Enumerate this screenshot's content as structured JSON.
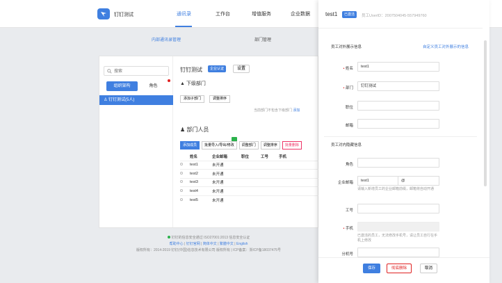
{
  "app": {
    "title": "钉钉测试"
  },
  "topnav": [
    {
      "label": "通讯录",
      "active": true
    },
    {
      "label": "工作台",
      "active": false
    },
    {
      "label": "增值服务",
      "active": false
    },
    {
      "label": "企业数据",
      "active": false
    }
  ],
  "subnav": [
    {
      "label": "内部通讯录管理",
      "active": true
    },
    {
      "label": "部门管理",
      "active": false
    }
  ],
  "left": {
    "search_placeholder": "搜索",
    "tabs": [
      {
        "label": "组织架构",
        "active": true
      },
      {
        "label": "角色",
        "active": false
      }
    ],
    "tree_item": "钉钉测试(5人)"
  },
  "org": {
    "name": "钉钉测试",
    "badge": "企业认证",
    "settings_label": "设置",
    "sub_dept_title": "下级部门",
    "add_sub_dept": "添加子部门",
    "sort": "调整排序",
    "note": "当前部门不包含下级部门",
    "note_link": "添加",
    "members_title": "部门人员"
  },
  "member_toolbar": [
    "添加成员",
    "批量导入/导出/修改",
    "调整部门",
    "调整排序",
    "批量删除"
  ],
  "table": {
    "headers": [
      "",
      "姓名",
      "企业邮箱",
      "职位",
      "工号",
      "手机"
    ],
    "rows": [
      {
        "name": "test1",
        "email": "未开通"
      },
      {
        "name": "test2",
        "email": "未开通"
      },
      {
        "name": "test3",
        "email": "未开通"
      },
      {
        "name": "test4",
        "email": "未开通"
      },
      {
        "name": "test5",
        "email": "未开通"
      }
    ]
  },
  "footer": {
    "line1": "钉钉的信息安全通过 ISO27001:2013 信息安全认证",
    "links": [
      "帮助中心",
      "钉钉官网",
      "简体中文",
      "繁體中文",
      "English"
    ],
    "line3": "版权所有：2014-2019 钉钉(中国)信息技术有限公司 版权所有 | ICP备案：浙ICP备18037475号"
  },
  "panel": {
    "name": "test1",
    "badge": "已激活",
    "userid": "员工UserID：2007504045-557949760",
    "section1": "员工对外展示信息",
    "section1_link": "自定义员工对外展示的信息",
    "fields1": [
      {
        "label": "姓名",
        "required": true,
        "value": "test1"
      },
      {
        "label": "部门",
        "required": true,
        "value": "钉钉测试"
      },
      {
        "label": "职位",
        "required": false,
        "value": ""
      },
      {
        "label": "邮箱",
        "required": false,
        "value": ""
      }
    ],
    "section2": "员工对内隐藏信息",
    "role_label": "角色",
    "email_label": "企业邮箱",
    "email_value": "test1",
    "email_domain": "@",
    "email_help": "请输入新增员工的企业邮箱前缀，邮箱将自动开通",
    "jobno_label": "工号",
    "phone_label": "手机",
    "phone_help": "已激活的员工，无法修改手机号，请让员工自行在手机上修改",
    "ext_label": "分机号",
    "btn_save": "保存",
    "btn_delete": "彻底删除",
    "btn_cancel": "取消"
  }
}
